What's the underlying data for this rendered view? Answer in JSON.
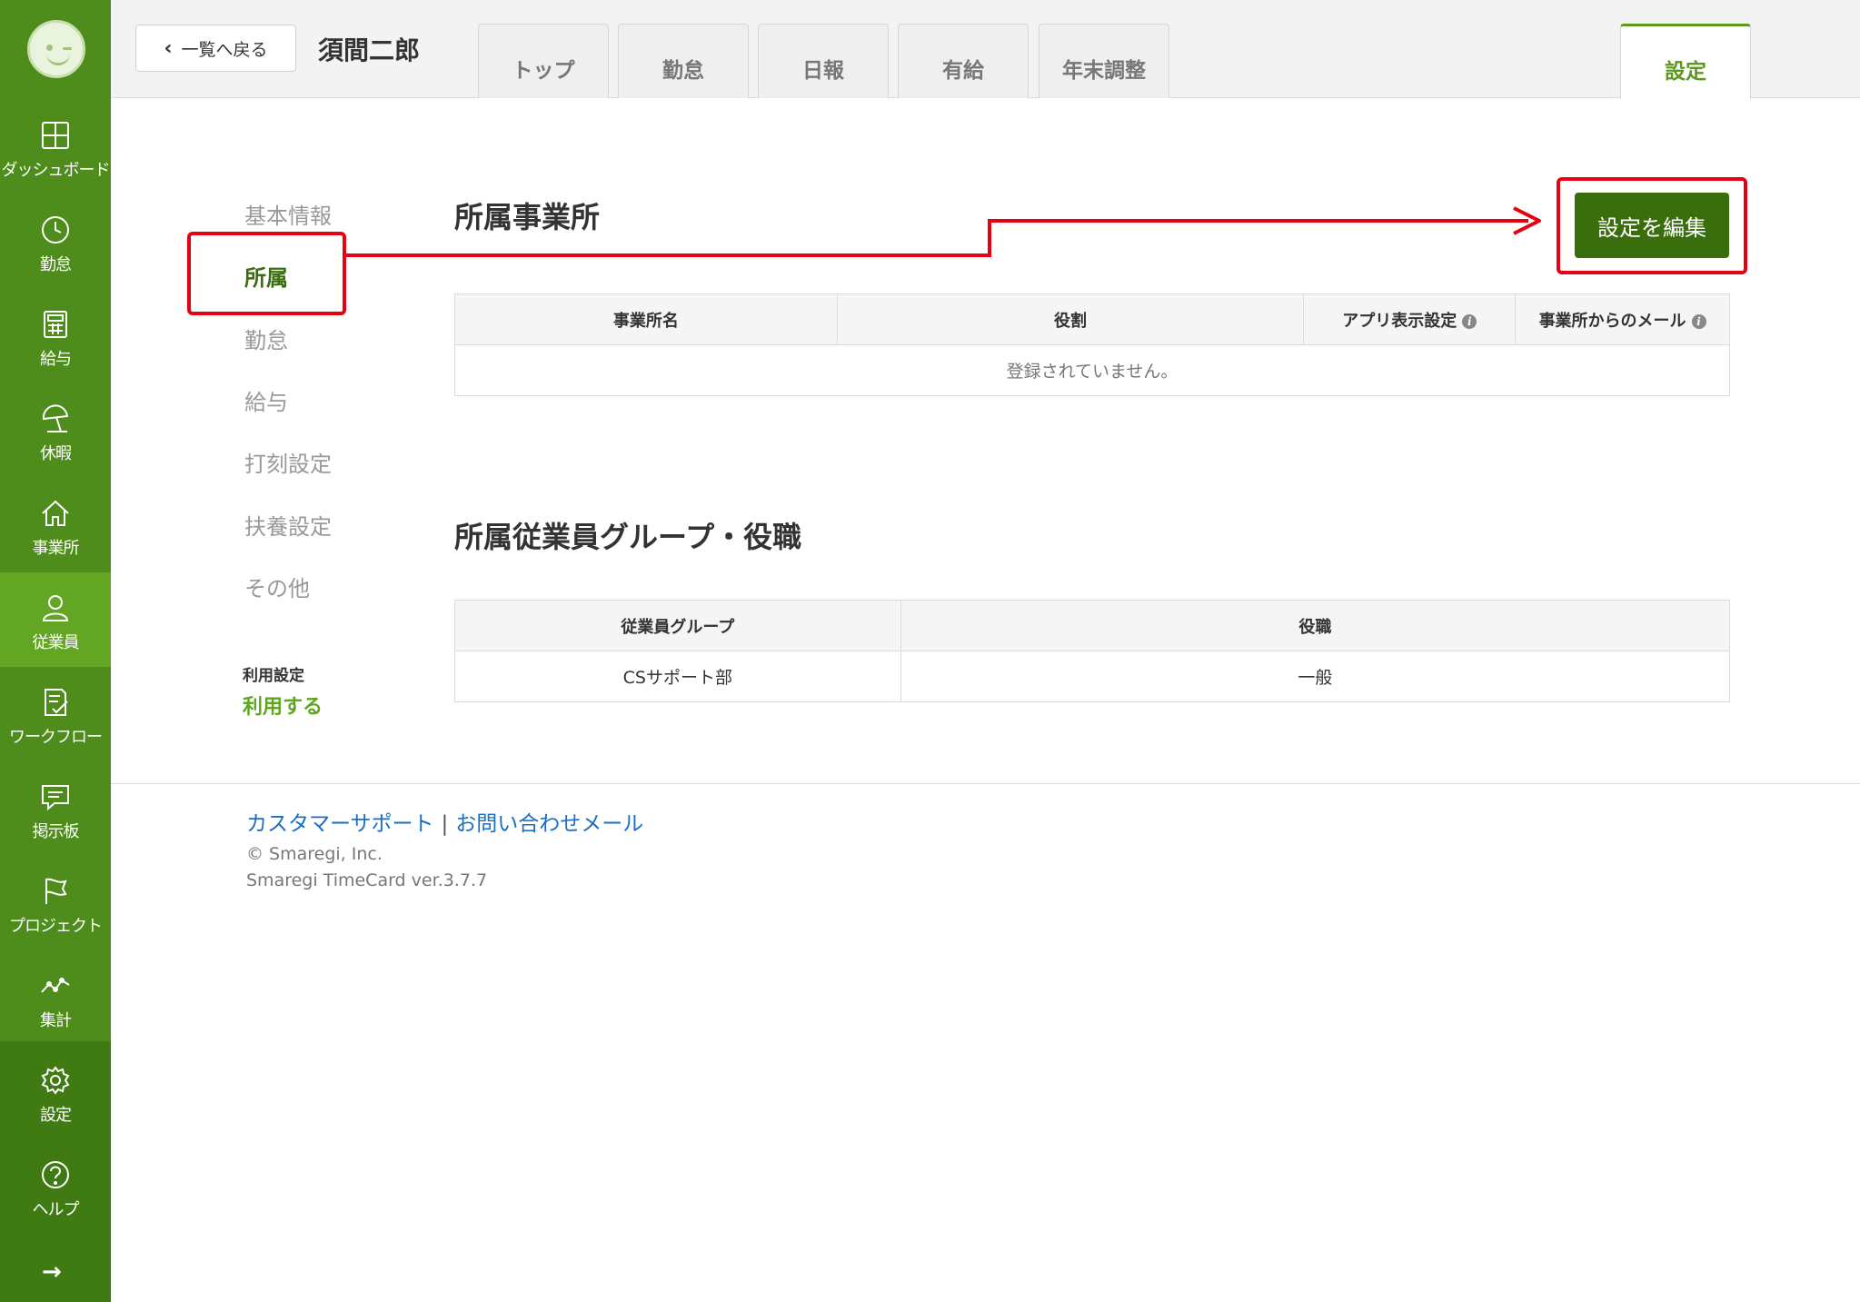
{
  "sidebar": {
    "items": [
      {
        "label": "ダッシュボード",
        "icon": "dashboard-icon"
      },
      {
        "label": "勤怠",
        "icon": "clock-icon"
      },
      {
        "label": "給与",
        "icon": "calculator-icon"
      },
      {
        "label": "休暇",
        "icon": "umbrella-icon"
      },
      {
        "label": "事業所",
        "icon": "home-icon"
      },
      {
        "label": "従業員",
        "icon": "person-icon"
      },
      {
        "label": "ワークフロー",
        "icon": "checklist-icon"
      },
      {
        "label": "掲示板",
        "icon": "message-icon"
      },
      {
        "label": "プロジェクト",
        "icon": "flag-icon"
      },
      {
        "label": "集計",
        "icon": "chart-line-icon"
      },
      {
        "label": "設定",
        "icon": "gear-icon"
      },
      {
        "label": "ヘルプ",
        "icon": "help-icon"
      }
    ],
    "active_item": "従業員",
    "accent_color": "#4e8c1c",
    "active_color": "#63a623"
  },
  "header": {
    "back_label": "一覧へ戻る",
    "employee_name": "須間二郎",
    "tabs": [
      {
        "label": "トップ"
      },
      {
        "label": "勤怠"
      },
      {
        "label": "日報"
      },
      {
        "label": "有給"
      },
      {
        "label": "年末調整"
      },
      {
        "label": "設定"
      }
    ],
    "active_tab": "設定"
  },
  "subnav": {
    "items": [
      {
        "label": "基本情報"
      },
      {
        "label": "所属"
      },
      {
        "label": "勤怠"
      },
      {
        "label": "給与"
      },
      {
        "label": "打刻設定"
      },
      {
        "label": "扶養設定"
      },
      {
        "label": "その他"
      }
    ],
    "active_item": "所属",
    "usage_label": "利用設定",
    "usage_value": "利用する"
  },
  "offices": {
    "title": "所属事業所",
    "edit_button": "設定を編集",
    "columns": [
      "事業所名",
      "役割",
      "アプリ表示設定",
      "事業所からのメール"
    ],
    "empty_message": "登録されていません。"
  },
  "groups": {
    "title": "所属従業員グループ・役職",
    "columns": [
      "従業員グループ",
      "役職"
    ],
    "rows": [
      {
        "group": "CSサポート部",
        "position": "一般"
      }
    ]
  },
  "footer": {
    "support_link": "カスタマーサポート",
    "separator": "|",
    "contact_link": "お問い合わせメール",
    "copyright": "© Smaregi, Inc.",
    "version": "Smaregi TimeCard ver.3.7.7"
  },
  "annotation_color": "#e60012"
}
